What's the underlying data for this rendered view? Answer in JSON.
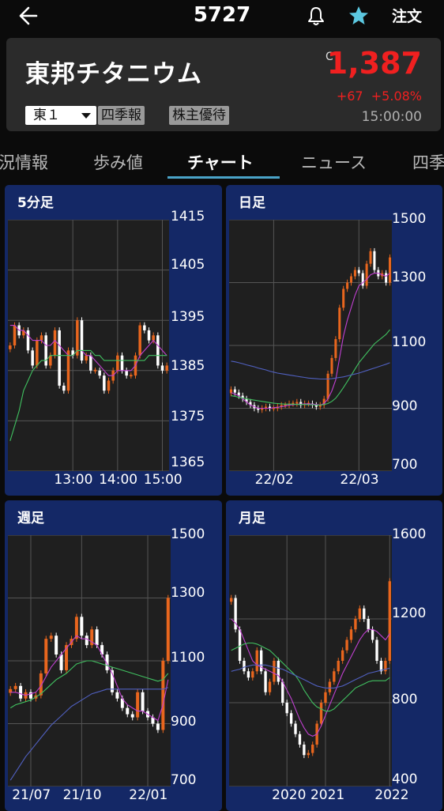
{
  "header": {
    "title": "5727",
    "order_label": "注文"
  },
  "stock": {
    "name": "東邦チタニウム",
    "market": "東１",
    "tags": [
      "四季報",
      "株主優待"
    ],
    "close_mark": "C",
    "price": "1,387",
    "change": "+67",
    "change_pct": "+5.08%",
    "time": "15:00:00",
    "colors": {
      "up": "#f02020",
      "accent": "#4aa3c8",
      "panel": "#142866",
      "candle_up": "#e8661e",
      "candle_down": "#ffffff"
    }
  },
  "tabs": [
    {
      "label": "況情報"
    },
    {
      "label": "歩み値"
    },
    {
      "label": "チャート",
      "active": true
    },
    {
      "label": "ニュース"
    },
    {
      "label": "四季"
    }
  ],
  "chart_data": [
    {
      "type": "candlestick",
      "title": "5分足",
      "y_ticks": [
        "1415",
        "1405",
        "1395",
        "1385",
        "1375",
        "1365"
      ],
      "ylim": [
        1365,
        1415
      ],
      "x_ticks": [
        "13:00",
        "14:00",
        "15:00"
      ],
      "x_tick_index": [
        14,
        24,
        34
      ],
      "close": [
        1390,
        1394,
        1392,
        1393,
        1389,
        1386,
        1391,
        1392,
        1386,
        1388,
        1393,
        1382,
        1381,
        1389,
        1388,
        1395,
        1387,
        1388,
        1385,
        1385,
        1384,
        1381,
        1383,
        1385,
        1388,
        1385,
        1384,
        1384,
        1388,
        1394,
        1393,
        1391,
        1392,
        1386,
        1385,
        1386
      ],
      "ma": [
        {
          "color": "#c040d0",
          "values": [
            1394,
            1394,
            1393,
            1393,
            1392,
            1391,
            1391,
            1391,
            1390,
            1390,
            1391,
            1390,
            1389,
            1388,
            1388,
            1389,
            1389,
            1388,
            1388,
            1387,
            1386,
            1385,
            1384,
            1384,
            1385,
            1385,
            1385,
            1385,
            1386,
            1388,
            1389,
            1390,
            1391,
            1390,
            1389,
            1388
          ]
        },
        {
          "color": "#40c060",
          "values": [
            1371,
            1374,
            1377,
            1381,
            1383,
            1385,
            1386,
            1387,
            1387,
            1388,
            1388,
            1388,
            1388,
            1388,
            1388,
            1389,
            1389,
            1389,
            1389,
            1388,
            1388,
            1387,
            1387,
            1387,
            1387,
            1387,
            1387,
            1387,
            1387,
            1387,
            1387,
            1388,
            1388,
            1388,
            1388,
            1388
          ]
        }
      ]
    },
    {
      "type": "candlestick",
      "title": "日足",
      "y_ticks": [
        "1500",
        "1300",
        "1100",
        "900",
        "700"
      ],
      "ylim": [
        700,
        1500
      ],
      "x_ticks": [
        "22/02",
        "22/03"
      ],
      "x_tick_index": [
        11,
        33
      ],
      "close": [
        960,
        950,
        940,
        930,
        920,
        910,
        900,
        895,
        900,
        905,
        900,
        900,
        905,
        910,
        910,
        915,
        915,
        920,
        910,
        915,
        915,
        910,
        905,
        910,
        930,
        1010,
        1060,
        1120,
        1220,
        1280,
        1300,
        1320,
        1340,
        1330,
        1290,
        1360,
        1400,
        1340,
        1320,
        1330,
        1300,
        1380
      ],
      "ma": [
        {
          "color": "#c040d0",
          "values": [
            950,
            945,
            940,
            930,
            920,
            910,
            905,
            900,
            900,
            900,
            900,
            902,
            903,
            905,
            907,
            910,
            911,
            913,
            913,
            914,
            914,
            913,
            912,
            910,
            915,
            930,
            955,
            990,
            1060,
            1130,
            1180,
            1220,
            1260,
            1290,
            1300,
            1310,
            1325,
            1330,
            1330,
            1325,
            1320,
            1330
          ]
        },
        {
          "color": "#40c060",
          "values": [
            940,
            938,
            935,
            933,
            930,
            928,
            926,
            924,
            922,
            920,
            918,
            916,
            915,
            914,
            913,
            913,
            913,
            912,
            912,
            912,
            911,
            911,
            910,
            910,
            912,
            915,
            922,
            932,
            948,
            966,
            985,
            1005,
            1025,
            1045,
            1060,
            1075,
            1090,
            1105,
            1115,
            1125,
            1135,
            1150
          ]
        },
        {
          "color": "#5060c0",
          "values": [
            1050,
            1048,
            1045,
            1042,
            1038,
            1035,
            1032,
            1028,
            1025,
            1022,
            1018,
            1015,
            1012,
            1010,
            1008,
            1006,
            1004,
            1002,
            1000,
            998,
            996,
            995,
            994,
            993,
            993,
            993,
            994,
            996,
            998,
            1000,
            1003,
            1006,
            1009,
            1012,
            1016,
            1020,
            1024,
            1028,
            1032,
            1036,
            1040,
            1045
          ]
        }
      ]
    },
    {
      "type": "candlestick",
      "title": "週足",
      "y_ticks": [
        "1500",
        "1300",
        "1100",
        "900",
        "700"
      ],
      "ylim": [
        700,
        1500
      ],
      "x_ticks": [
        "21/07",
        "21/10",
        "22/01"
      ],
      "x_tick_index": [
        4,
        14,
        27
      ],
      "close": [
        1010,
        1020,
        980,
        1000,
        980,
        990,
        1060,
        1170,
        1180,
        1120,
        1070,
        1150,
        1170,
        1240,
        1180,
        1150,
        1200,
        1150,
        1120,
        1070,
        1000,
        980,
        950,
        930,
        920,
        1000,
        940,
        920,
        900,
        880,
        1100,
        1300
      ],
      "ma": [
        {
          "color": "#c040d0",
          "values": [
            1000,
            1000,
            995,
            990,
            995,
            1000,
            1020,
            1050,
            1080,
            1100,
            1120,
            1140,
            1160,
            1180,
            1170,
            1170,
            1160,
            1150,
            1120,
            1090,
            1060,
            1020,
            980,
            960,
            950,
            940,
            940,
            930,
            920,
            910,
            960,
            1040
          ]
        },
        {
          "color": "#40c060",
          "values": [
            950,
            960,
            965,
            970,
            975,
            985,
            995,
            1010,
            1025,
            1040,
            1050,
            1060,
            1075,
            1090,
            1095,
            1100,
            1100,
            1095,
            1090,
            1085,
            1080,
            1075,
            1070,
            1065,
            1060,
            1055,
            1050,
            1045,
            1040,
            1035,
            1040,
            1060
          ]
        },
        {
          "color": "#5060c0",
          "values": [
            720,
            745,
            770,
            795,
            815,
            835,
            855,
            875,
            895,
            910,
            925,
            940,
            955,
            965,
            975,
            985,
            995,
            1000,
            1005,
            1010,
            1010,
            1010,
            1010,
            1010,
            1010,
            1010,
            1010,
            1010,
            1010,
            1010,
            1010,
            1015
          ]
        }
      ]
    },
    {
      "type": "candlestick",
      "title": "月足",
      "y_ticks": [
        "1600",
        "1200",
        "800",
        "400"
      ],
      "ylim": [
        400,
        1600
      ],
      "x_ticks": [
        "2020",
        "2021",
        "2022"
      ],
      "x_tick_index": [
        13,
        22,
        37
      ],
      "close": [
        1300,
        1150,
        1000,
        950,
        920,
        950,
        1050,
        950,
        850,
        900,
        1000,
        900,
        800,
        750,
        700,
        650,
        600,
        550,
        560,
        600,
        700,
        800,
        850,
        900,
        950,
        1000,
        1050,
        1100,
        1150,
        1200,
        1250,
        1200,
        1150,
        1100,
        1000,
        950,
        1000,
        1380
      ],
      "ma": [
        {
          "color": "#c040d0",
          "values": [
            1200,
            1180,
            1150,
            1100,
            1050,
            1000,
            980,
            970,
            960,
            950,
            940,
            930,
            900,
            860,
            820,
            770,
            720,
            680,
            650,
            640,
            650,
            690,
            740,
            790,
            840,
            890,
            940,
            980,
            1020,
            1060,
            1100,
            1130,
            1150,
            1150,
            1140,
            1120,
            1100,
            1130
          ]
        },
        {
          "color": "#40c060",
          "values": [
            1050,
            1060,
            1070,
            1080,
            1085,
            1085,
            1080,
            1070,
            1060,
            1050,
            1030,
            1010,
            990,
            970,
            950,
            930,
            900,
            860,
            830,
            800,
            780,
            770,
            760,
            760,
            770,
            790,
            810,
            830,
            850,
            870,
            880,
            890,
            900,
            905,
            905,
            905,
            905,
            920
          ]
        },
        {
          "color": "#5060c0",
          "values": [
            950,
            955,
            960,
            970,
            975,
            980,
            980,
            980,
            980,
            975,
            970,
            965,
            960,
            950,
            940,
            930,
            920,
            910,
            900,
            890,
            880,
            875,
            870,
            870,
            870,
            875,
            880,
            890,
            900,
            910,
            920,
            930,
            940,
            945,
            950,
            955,
            960,
            965
          ]
        }
      ]
    }
  ]
}
